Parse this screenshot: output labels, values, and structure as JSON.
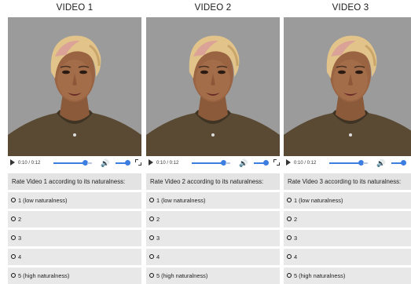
{
  "videos": [
    {
      "title": "VIDEO 1",
      "time": "0:10 / 0:12",
      "progress": 0.83,
      "volume": 0.95,
      "question": "Rate Video 1 according to its naturalness:",
      "options": [
        "1 (low naturalness)",
        "2",
        "3",
        "4",
        "5 (high naturalness)"
      ]
    },
    {
      "title": "VIDEO 2",
      "time": "0:10 / 0:12",
      "progress": 0.83,
      "volume": 0.95,
      "question": "Rate Video 2 according to its naturalness:",
      "options": [
        "1 (low naturalness)",
        "2",
        "3",
        "4",
        "5 (high naturalness)"
      ]
    },
    {
      "title": "VIDEO 3",
      "time": "0:10 / 0:12",
      "progress": 0.83,
      "volume": 0.95,
      "question": "Rate Video 3 according to its naturalness:",
      "options": [
        "1 (low naturalness)",
        "2",
        "3",
        "4",
        "5 (high naturalness)"
      ]
    }
  ],
  "colors": {
    "accent": "#3b7de0",
    "video_bg": "#9a9a9a",
    "option_bg": "#e8e8e8"
  },
  "icons": [
    "play-icon",
    "volume-icon",
    "fullscreen-icon",
    "radio-icon"
  ]
}
